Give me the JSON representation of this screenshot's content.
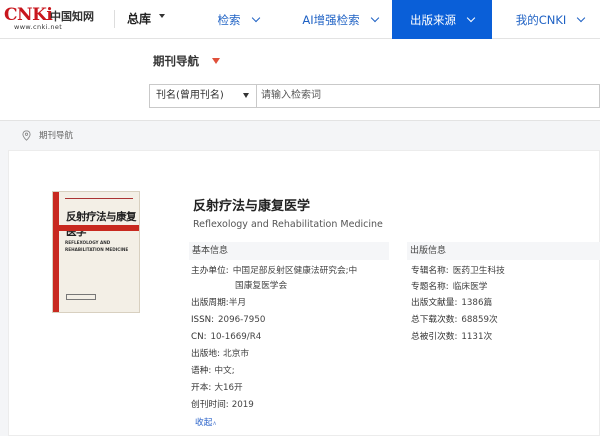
{
  "logo": {
    "mark": "CNKi",
    "cn": "中国知网",
    "url": "www.cnki.net"
  },
  "nav": {
    "zongku": "总库",
    "items": [
      {
        "label": "检索",
        "active": false
      },
      {
        "label": "AI增强检索",
        "active": false
      },
      {
        "label": "出版来源",
        "active": true
      },
      {
        "label": "我的CNKI",
        "active": false
      }
    ]
  },
  "search": {
    "nav_title": "期刊导航",
    "field_select": "刊名(曾用刊名)",
    "placeholder": "请输入检索词"
  },
  "breadcrumb": "期刊导航",
  "journal": {
    "title": "反射疗法与康复医学",
    "title_en": "Reflexology and Rehabilitation Medicine",
    "cover": {
      "title": "反射疗法与康复医学",
      "en": "REFLEXOLOGY AND REHABILITATION MEDICINE"
    },
    "basic_info": {
      "heading": "基本信息",
      "sponsor_label": "主办单位:",
      "sponsor_line1": "中国足部反射区健康法研究会;中",
      "sponsor_line2": "国康复医学会",
      "cycle_label": "出版周期:",
      "cycle": "半月",
      "issn_label": "ISSN:",
      "issn": "2096-7950",
      "cn_label": "CN:",
      "cn": "10-1669/R4",
      "place_label": "出版地:",
      "place": "北京市",
      "lang_label": "语种:",
      "lang": "中文;",
      "format_label": "开本:",
      "format": "大16开",
      "founded_label": "创刊时间:",
      "founded": "2019"
    },
    "pub_info": {
      "heading": "出版信息",
      "series_label": "专辑名称:",
      "series": "医药卫生科技",
      "topic_label": "专题名称:",
      "topic": "临床医学",
      "papers_label": "出版文献量:",
      "papers": "1386篇",
      "downloads_label": "总下载次数:",
      "downloads": "68859次",
      "cites_label": "总被引次数:",
      "cites": "1131次"
    },
    "favorite": "收起",
    "favorite_arrow": "∧"
  },
  "colors": {
    "accent": "#0a5fd8",
    "link": "#1e61c4",
    "caret": "#e0503a"
  }
}
